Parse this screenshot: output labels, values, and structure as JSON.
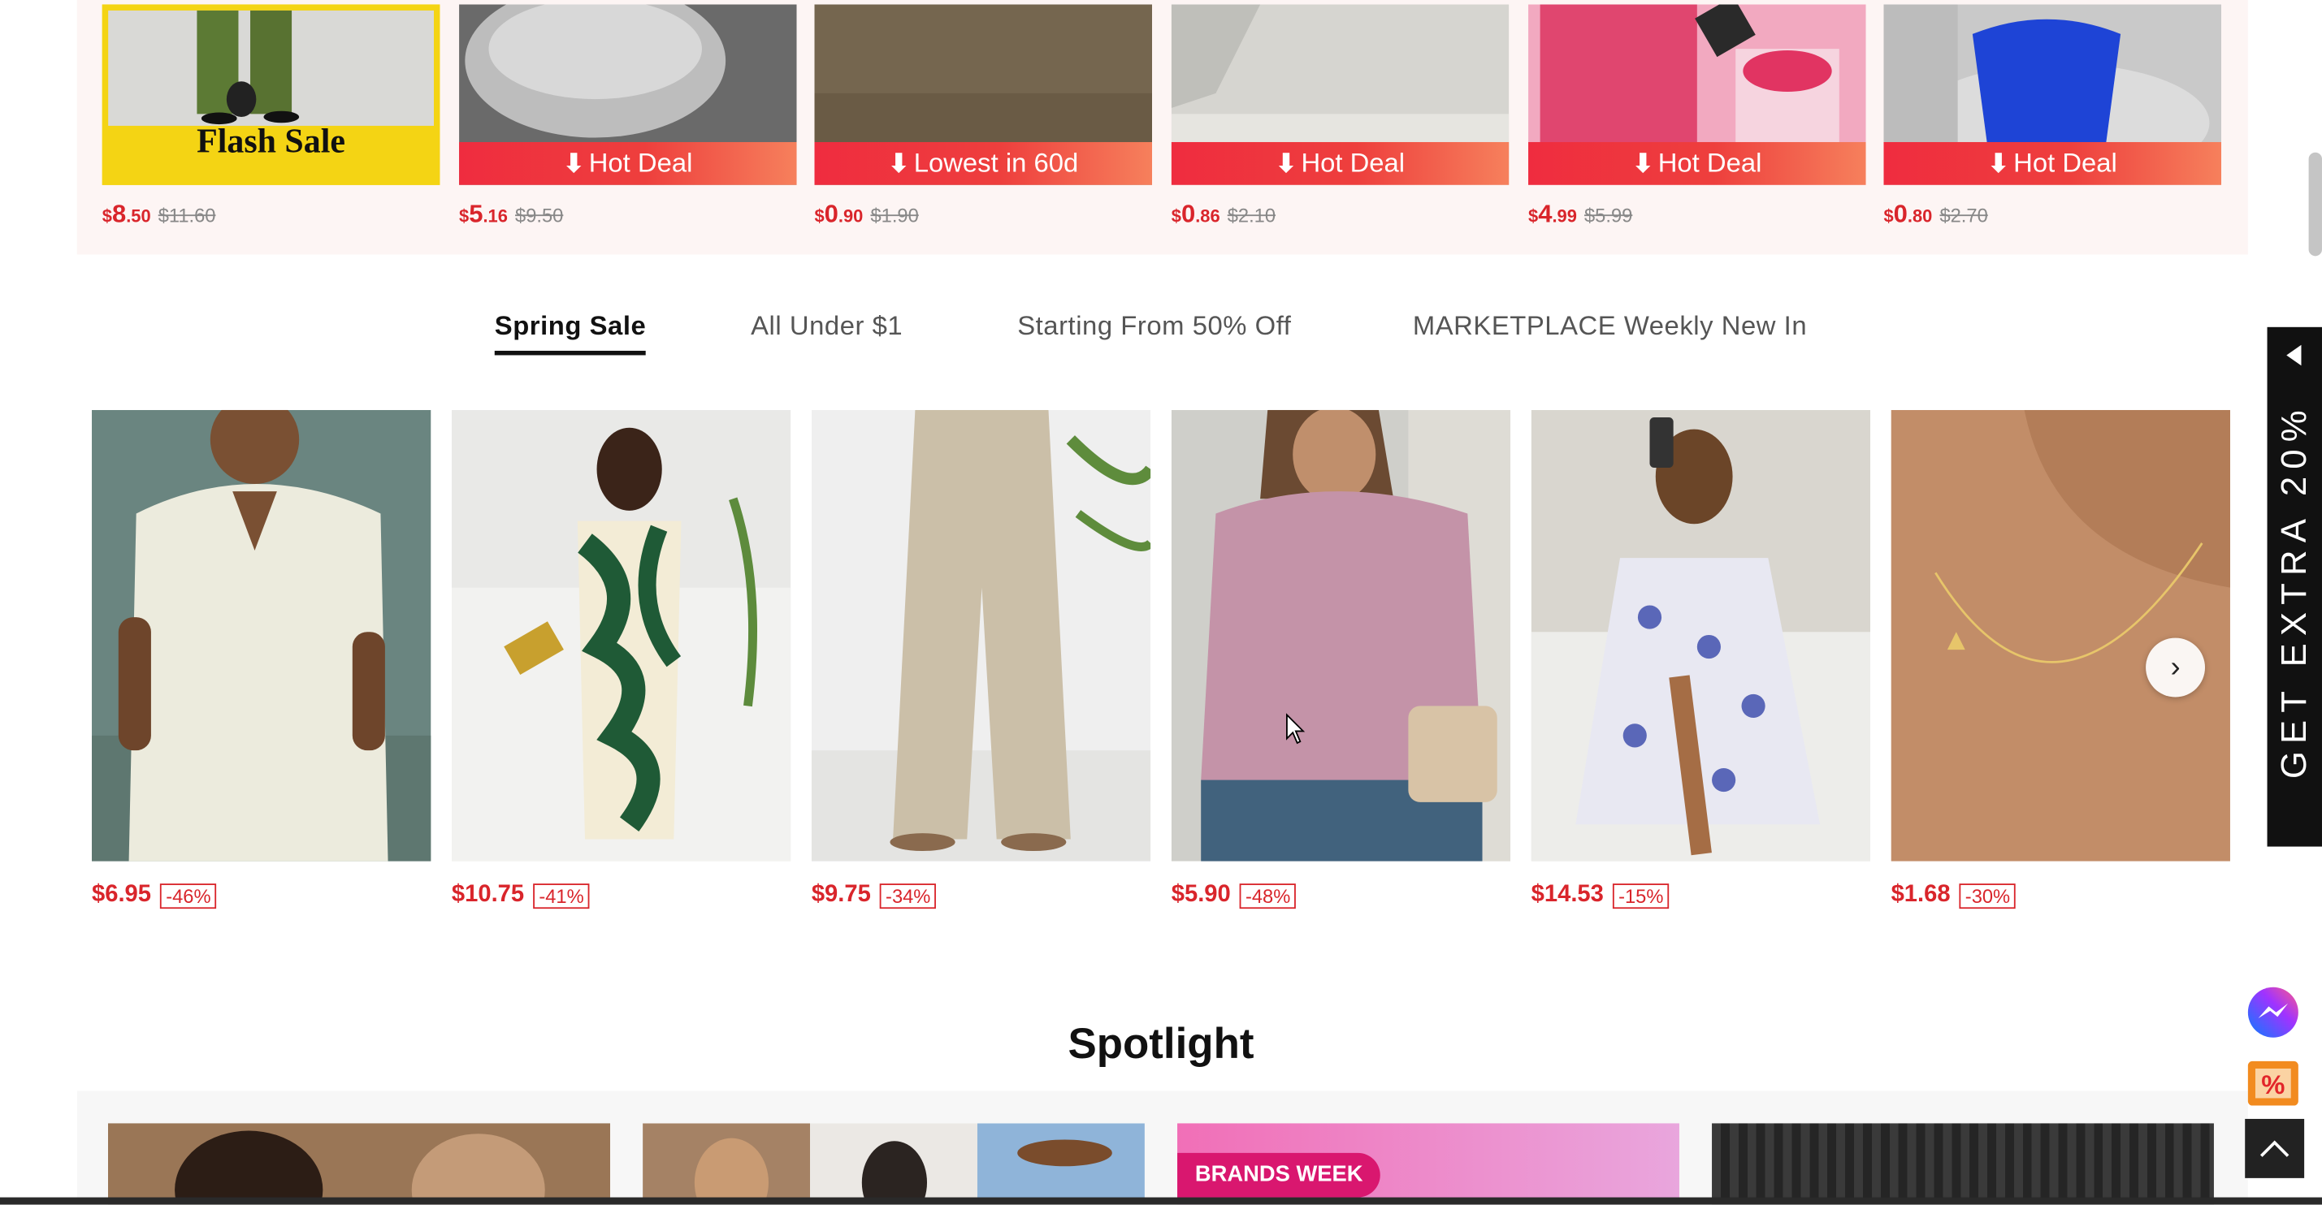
{
  "flash_items": [
    {
      "badge": "Flash Sale",
      "cur": "$",
      "main": "8",
      "cents": ".50",
      "old": "$11.60"
    },
    {
      "badge": "Hot Deal",
      "cur": "$",
      "main": "5",
      "cents": ".16",
      "old": "$9.50"
    },
    {
      "badge": "Lowest in 60d",
      "cur": "$",
      "main": "0",
      "cents": ".90",
      "old": "$1.90"
    },
    {
      "badge": "Hot Deal",
      "cur": "$",
      "main": "0",
      "cents": ".86",
      "old": "$2.10"
    },
    {
      "badge": "Hot Deal",
      "cur": "$",
      "main": "4",
      "cents": ".99",
      "old": "$5.99"
    },
    {
      "badge": "Hot Deal",
      "cur": "$",
      "main": "0",
      "cents": ".80",
      "old": "$2.70"
    }
  ],
  "tabs": [
    "Spring Sale",
    "All Under $1",
    "Starting From 50% Off",
    "MARKETPLACE Weekly New In"
  ],
  "active_tab": "Spring Sale",
  "products": [
    {
      "price": "$6.95",
      "discount": "-46%"
    },
    {
      "price": "$10.75",
      "discount": "-41%"
    },
    {
      "price": "$9.75",
      "discount": "-34%"
    },
    {
      "price": "$5.90",
      "discount": "-48%"
    },
    {
      "price": "$14.53",
      "discount": "-15%"
    },
    {
      "price": "$1.68",
      "discount": "-30%"
    }
  ],
  "side_promo": "GET EXTRA 20%",
  "spotlight": {
    "title": "Spotlight",
    "brands_week": "BRANDS WEEK"
  },
  "icons": {
    "next": "chevron-right-icon",
    "messenger": "messenger-icon",
    "coupon": "coupon-icon",
    "top": "back-to-top-icon"
  },
  "colors": {
    "accent_red": "#d9252b",
    "badge_red": "#ef2c3f",
    "flash_yellow": "#f4d414"
  }
}
